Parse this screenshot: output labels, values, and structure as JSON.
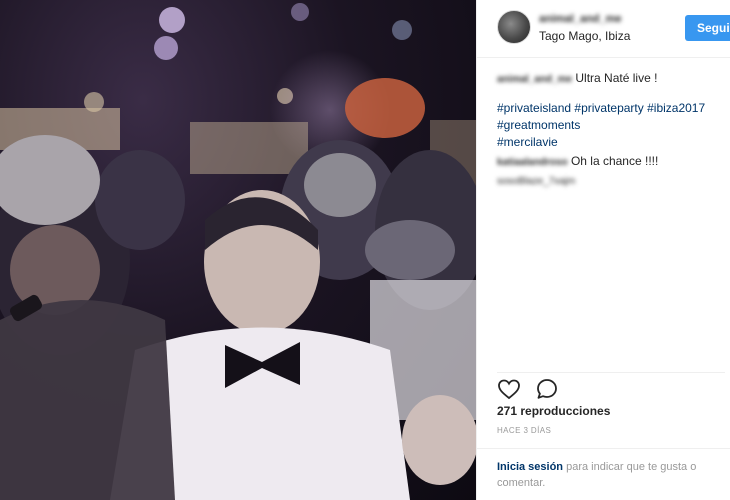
{
  "post": {
    "username": "animal_and_me",
    "location": "Tago Mago, Ibiza",
    "follow_label": "Seguir",
    "caption_text": "Ultra Naté live !",
    "hashtags": [
      "#privateisland",
      "#privateparty",
      "#ibiza2017",
      "#greatmoments",
      "#mercilavie"
    ],
    "comments": [
      {
        "user": "katiaalandroso",
        "text": "Oh la chance !!!!"
      },
      {
        "user": "",
        "text": "sosoBlaze_7xajm"
      }
    ],
    "views": "271 reproducciones",
    "time_ago": "HACE 3 DÍAS",
    "login_link": "Inicia sesión",
    "login_text": " para indicar que te gusta o comentar."
  },
  "icons": {
    "like": "heart-icon",
    "comment": "comment-icon"
  },
  "colors": {
    "accent": "#3897f0",
    "link": "#003569",
    "muted": "#999999",
    "text": "#262626"
  }
}
